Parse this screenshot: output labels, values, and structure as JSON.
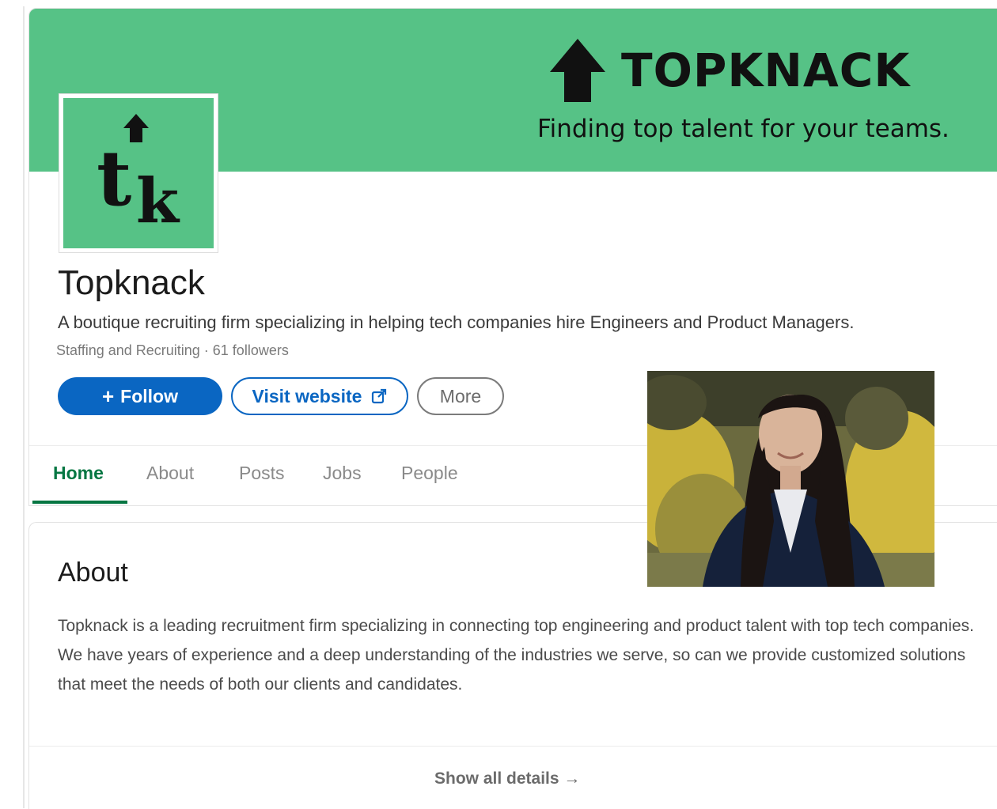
{
  "banner": {
    "brand": "TOPKNACK",
    "tagline": "Finding top talent for your teams.",
    "color": "#56c286"
  },
  "logo": {
    "text_t": "t",
    "text_k": "k",
    "icon": "arrow-up-icon"
  },
  "company": {
    "name": "Topknack",
    "tagline": "A boutique recruiting firm specializing in helping tech companies hire Engineers and Product Managers.",
    "meta": "Staffing and Recruiting · 61 followers"
  },
  "buttons": {
    "follow_plus": "+",
    "follow_label": "Follow",
    "visit_label": "Visit website",
    "visit_icon": "external-link-icon",
    "more_label": "More"
  },
  "tabs": [
    {
      "label": "Home",
      "active": true
    },
    {
      "label": "About",
      "active": false
    },
    {
      "label": "Posts",
      "active": false
    },
    {
      "label": "Jobs",
      "active": false
    },
    {
      "label": "People",
      "active": false
    }
  ],
  "about": {
    "title": "About",
    "text": "Topknack is a leading recruitment firm specializing in connecting top engineering and product talent with top tech companies. We have years of experience and a deep understanding of the industries we serve, so can we provide customized solutions that meet the needs of both our clients and candidates.",
    "show_all": "Show all details",
    "show_all_arrow": "→"
  },
  "colors": {
    "primary_blue": "#0a66c2",
    "active_green": "#057642"
  }
}
